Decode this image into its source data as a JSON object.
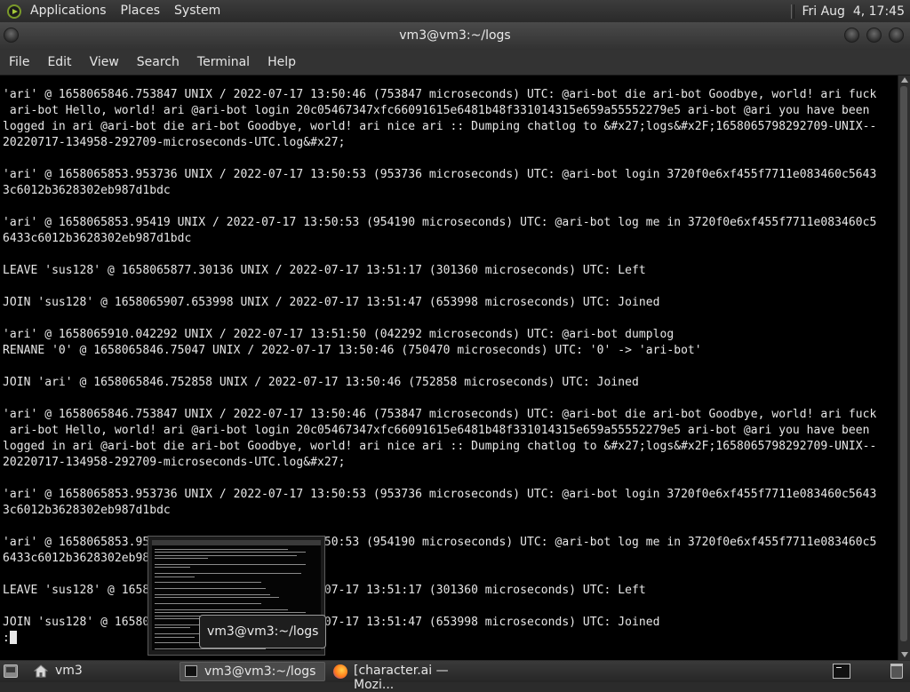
{
  "top_panel": {
    "menus": [
      "Applications",
      "Places",
      "System"
    ],
    "clock": "Fri Aug  4, 17:45"
  },
  "window": {
    "title": "vm3@vm3:~/logs",
    "menus": [
      "File",
      "Edit",
      "View",
      "Search",
      "Terminal",
      "Help"
    ]
  },
  "terminal": {
    "lines": [
      "'ari' @ 1658065846.753847 UNIX / 2022-07-17 13:50:46 (753847 microseconds) UTC: @ari-bot die ari-bot Goodbye, world! ari fuck",
      " ari-bot Hello, world! ari @ari-bot login 20c05467347xfc66091615e6481b48f331014315e659a55552279e5 ari-bot @ari you have been",
      "logged in ari @ari-bot die ari-bot Goodbye, world! ari nice ari :: Dumping chatlog to &#x27;logs&#x2F;1658065798292709-UNIX--",
      "20220717-134958-292709-microseconds-UTC.log&#x27;",
      "",
      "'ari' @ 1658065853.953736 UNIX / 2022-07-17 13:50:53 (953736 microseconds) UTC: @ari-bot login 3720f0e6xf455f7711e083460c5643",
      "3c6012b3628302eb987d1bdc",
      "",
      "'ari' @ 1658065853.95419 UNIX / 2022-07-17 13:50:53 (954190 microseconds) UTC: @ari-bot log me in 3720f0e6xf455f7711e083460c5",
      "6433c6012b3628302eb987d1bdc",
      "",
      "LEAVE 'sus128' @ 1658065877.30136 UNIX / 2022-07-17 13:51:17 (301360 microseconds) UTC: Left",
      "",
      "JOIN 'sus128' @ 1658065907.653998 UNIX / 2022-07-17 13:51:47 (653998 microseconds) UTC: Joined",
      "",
      "'ari' @ 1658065910.042292 UNIX / 2022-07-17 13:51:50 (042292 microseconds) UTC: @ari-bot dumplog",
      "RENANE '0' @ 1658065846.75047 UNIX / 2022-07-17 13:50:46 (750470 microseconds) UTC: '0' -> 'ari-bot'",
      "",
      "JOIN 'ari' @ 1658065846.752858 UNIX / 2022-07-17 13:50:46 (752858 microseconds) UTC: Joined",
      "",
      "'ari' @ 1658065846.753847 UNIX / 2022-07-17 13:50:46 (753847 microseconds) UTC: @ari-bot die ari-bot Goodbye, world! ari fuck",
      " ari-bot Hello, world! ari @ari-bot login 20c05467347xfc66091615e6481b48f331014315e659a55552279e5 ari-bot @ari you have been",
      "logged in ari @ari-bot die ari-bot Goodbye, world! ari nice ari :: Dumping chatlog to &#x27;logs&#x2F;1658065798292709-UNIX--",
      "20220717-134958-292709-microseconds-UTC.log&#x27;",
      "",
      "'ari' @ 1658065853.953736 UNIX / 2022-07-17 13:50:53 (953736 microseconds) UTC: @ari-bot login 3720f0e6xf455f7711e083460c5643",
      "3c6012b3628302eb987d1bdc",
      "",
      "'ari' @ 1658065853.95419 UNIX / 2022-07-17 13:50:53 (954190 microseconds) UTC: @ari-bot log me in 3720f0e6xf455f7711e083460c5",
      "6433c6012b3628302eb987d1bdc",
      "",
      "LEAVE 'sus128' @ 1658065877.30136 UNIX / 2022-07-17 13:51:17 (301360 microseconds) UTC: Left",
      "",
      "JOIN 'sus128' @ 1658065907.653998 UNIX / 2022-07-17 13:51:47 (653998 microseconds) UTC: Joined"
    ],
    "prompt": ":",
    "colors": {
      "background": "#000000",
      "foreground": "#e8e8e8"
    }
  },
  "taskbar": {
    "workspace_label": "vm3",
    "tasks": [
      {
        "label": "vm3@vm3:~/logs",
        "icon": "terminal-icon",
        "active": true
      },
      {
        "label": "[character.ai — Mozi...",
        "icon": "firefox-icon",
        "active": false
      }
    ],
    "preview_label": "vm3@vm3:~/logs"
  }
}
